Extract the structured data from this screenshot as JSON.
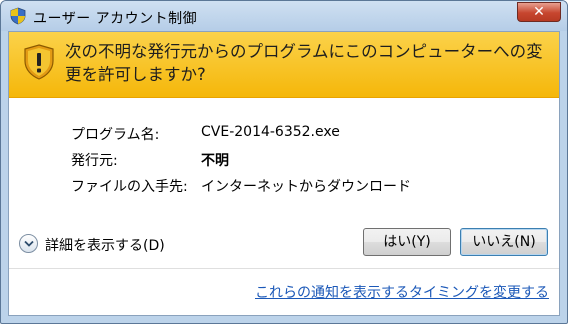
{
  "window": {
    "title": "ユーザー アカウント制御",
    "close_label": "✕"
  },
  "banner": {
    "message": "次の不明な発行元からのプログラムにこのコンピューターへの変更を許可しますか?"
  },
  "details": {
    "program_label": "プログラム名:",
    "program_value": "CVE-2014-6352.exe",
    "publisher_label": "発行元:",
    "publisher_value": "不明",
    "source_label": "ファイルの入手先:",
    "source_value": "インターネットからダウンロード"
  },
  "actions": {
    "show_details_label": "詳細を表示する(D)",
    "yes_label": "はい(Y)",
    "no_label": "いいえ(N)"
  },
  "footer": {
    "notification_link": "これらの通知を表示するタイミングを変更する"
  },
  "colors": {
    "banner": "#f5b70a",
    "link": "#1b58b8",
    "titlebar": "#bcd3ea"
  },
  "icons": {
    "title": "uac-shield-icon",
    "banner": "warning-shield-icon",
    "toggle": "chevron-down-icon",
    "close": "close-icon"
  }
}
